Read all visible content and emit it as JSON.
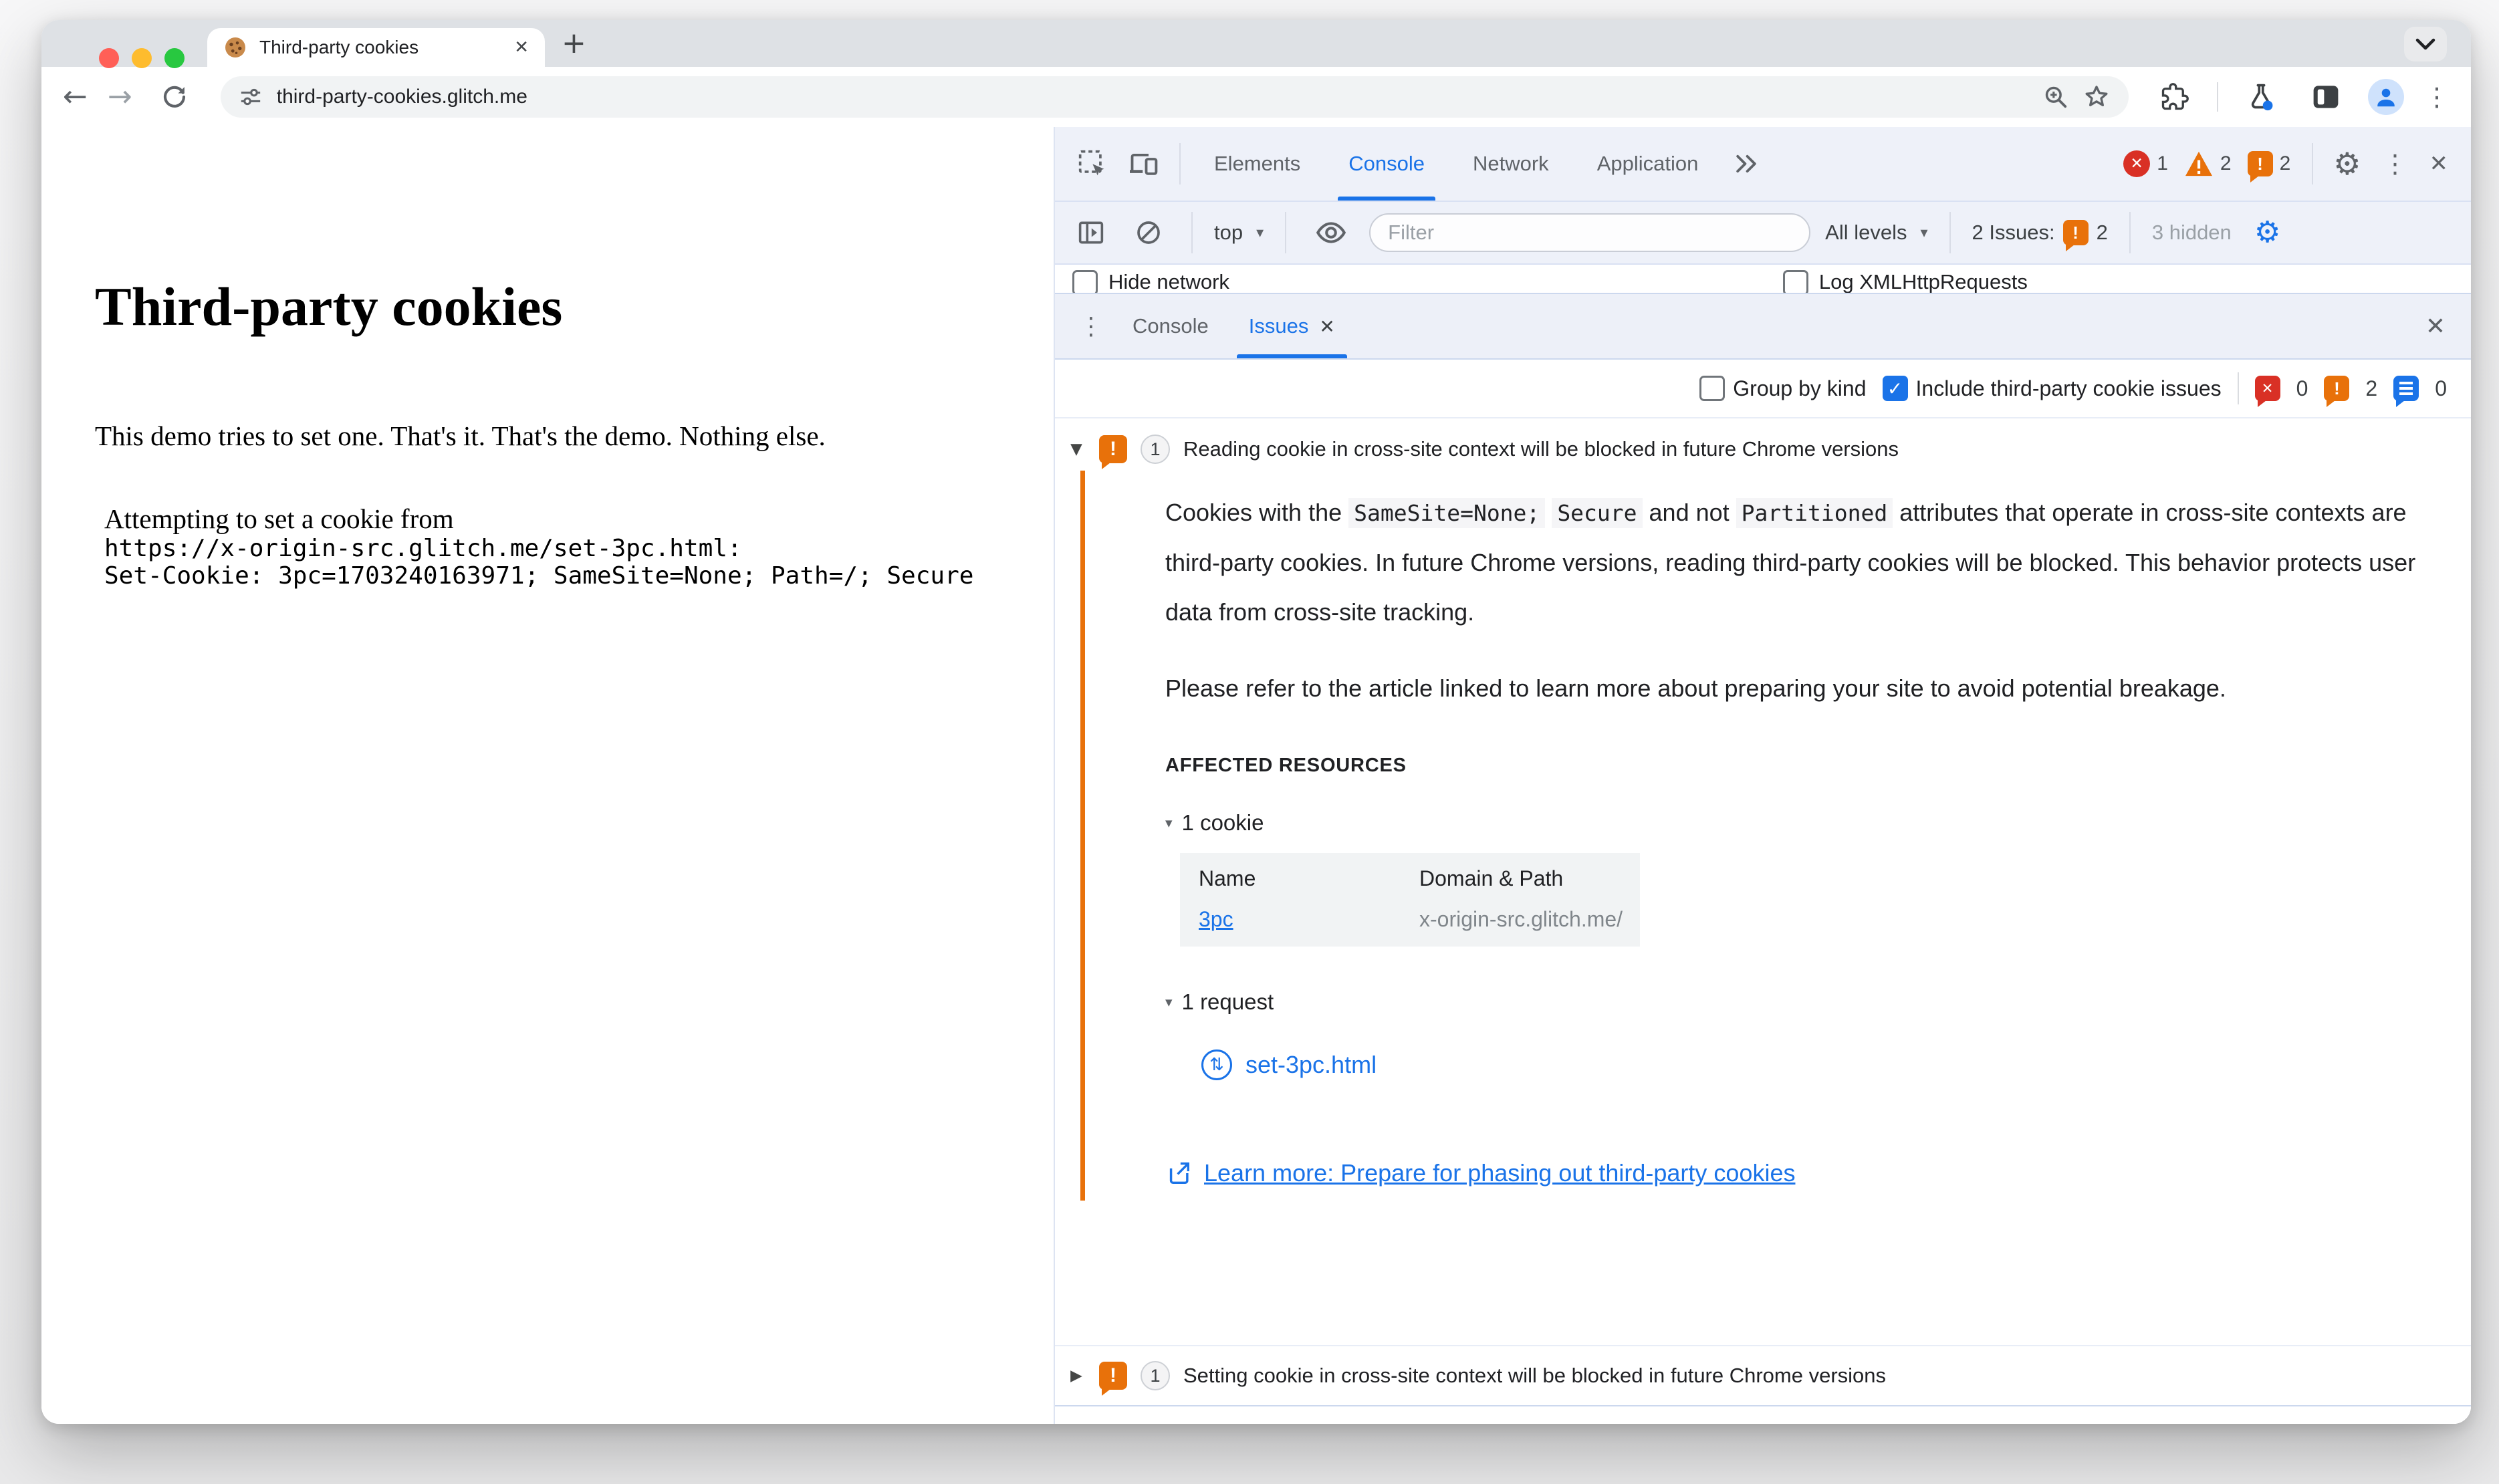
{
  "browser": {
    "tab_title": "Third-party cookies",
    "url": "third-party-cookies.glitch.me"
  },
  "page": {
    "heading": "Third-party cookies",
    "intro": "This demo tries to set one. That's it. That's the demo. Nothing else.",
    "log_line1": "Attempting to set a cookie from",
    "log_line2": "https://x-origin-src.glitch.me/set-3pc.html:",
    "log_line3": "Set-Cookie: 3pc=1703240163971; SameSite=None; Path=/; Secure"
  },
  "devtools": {
    "tabs": [
      "Elements",
      "Console",
      "Network",
      "Application"
    ],
    "badges": {
      "errors": "1",
      "warnings": "2",
      "issues": "2"
    },
    "console_toolbar": {
      "context": "top",
      "filter_placeholder": "Filter",
      "levels": "All levels",
      "issues_label": "2 Issues:",
      "issues_count": "2",
      "hidden_label": "3 hidden"
    },
    "console_settings": {
      "hide_network": "Hide network",
      "log_xhr": "Log XMLHttpRequests"
    },
    "drawer_tabs": {
      "console": "Console",
      "issues": "Issues"
    },
    "issues_toolbar": {
      "group_by_kind": "Group by kind",
      "include_third_party": "Include third-party cookie issues",
      "error_count": "0",
      "warning_count": "2",
      "info_count": "0"
    },
    "issue1": {
      "count": "1",
      "title": "Reading cookie in cross-site context will be blocked in future Chrome versions",
      "p1": {
        "t1": "Cookies with the ",
        "c1": "SameSite=None;",
        "s": " ",
        "c2": "Secure",
        "t2": " and not ",
        "c3": "Partitioned",
        "t3": " attributes that operate in cross-site contexts are third-party cookies. In future Chrome versions, reading third-party cookies will be blocked. This behavior protects user data from cross-site tracking."
      },
      "p2": "Please refer to the article linked to learn more about preparing your site to avoid potential breakage.",
      "affected_label": "AFFECTED RESOURCES",
      "cookie_group": "1 cookie",
      "cookie_table": {
        "col_name": "Name",
        "col_domain": "Domain & Path",
        "row_name": "3pc",
        "row_domain": "x-origin-src.glitch.me/"
      },
      "request_group": "1 request",
      "request_file": "set-3pc.html",
      "learn_more": "Learn more: Prepare for phasing out third-party cookies"
    },
    "issue2": {
      "count": "1",
      "title": "Setting cookie in cross-site context will be blocked in future Chrome versions"
    }
  },
  "icons": {
    "close": "✕",
    "plus": "+",
    "back": "←",
    "forward": "→",
    "kebab": "⋮",
    "gear": "⚙",
    "caret": "▾",
    "expand": "▼",
    "collapse": "▶",
    "check": "✓",
    "updown": "⇅",
    "bang": "!",
    "err_x": "✕"
  }
}
